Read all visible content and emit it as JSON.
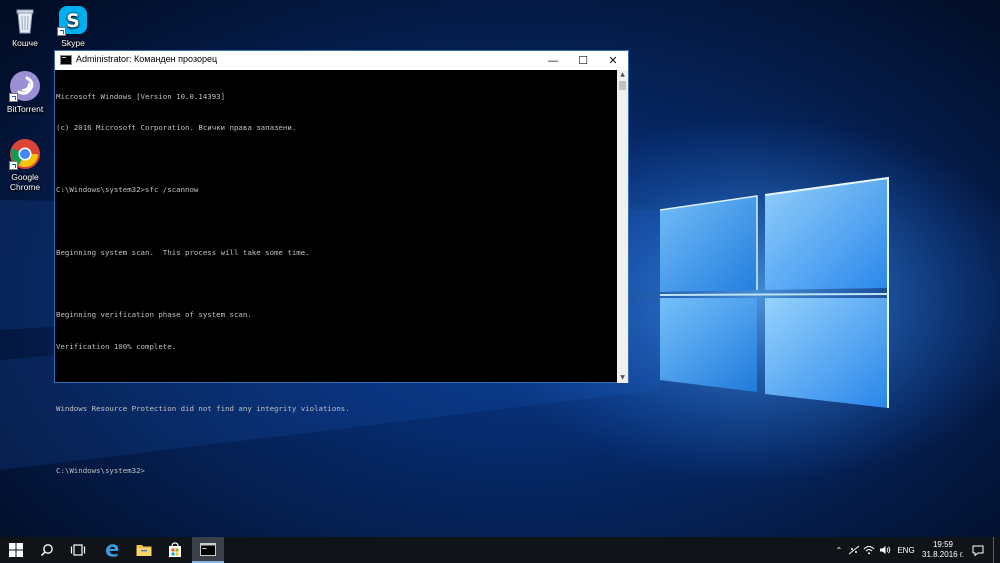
{
  "desktop": {
    "icons": [
      {
        "label": "Кошче",
        "icon": "recycle-bin-icon"
      },
      {
        "label": "Skype",
        "icon": "skype-icon"
      },
      {
        "label": "BitTorrent",
        "icon": "bittorrent-icon"
      },
      {
        "label": "Google Chrome",
        "icon": "chrome-icon"
      }
    ]
  },
  "window": {
    "title": "Administrator: Команден прозорец",
    "controls": {
      "minimize": "—",
      "maximize": "☐",
      "close": "✕"
    },
    "console_lines": [
      "Microsoft Windows [Version 10.0.14393]",
      "(c) 2016 Microsoft Corporation. Всички права запазени.",
      "",
      "C:\\Windows\\system32>sfc /scannow",
      "",
      "Beginning system scan.  This process will take some time.",
      "",
      "Beginning verification phase of system scan.",
      "Verification 100% complete.",
      "",
      "Windows Resource Protection did not find any integrity violations.",
      "",
      "C:\\Windows\\system32>"
    ]
  },
  "taskbar": {
    "buttons": [
      {
        "name": "start-button",
        "icon": "windows-logo-icon"
      },
      {
        "name": "search-button",
        "icon": "search-icon"
      },
      {
        "name": "task-view-button",
        "icon": "task-view-icon"
      },
      {
        "name": "edge-button",
        "icon": "edge-icon"
      },
      {
        "name": "file-explorer-button",
        "icon": "folder-icon"
      },
      {
        "name": "store-button",
        "icon": "store-icon"
      },
      {
        "name": "command-prompt-button",
        "icon": "console-icon"
      }
    ],
    "tray": {
      "language": "ENG",
      "time": "19:59",
      "date": "31.8.2016 г."
    }
  },
  "colors": {
    "wallpaper": "#0a3a8a",
    "taskbar": "#101318",
    "console_bg": "#000000",
    "console_text": "#c0c0c0",
    "window_border": "#3a6fb5"
  }
}
